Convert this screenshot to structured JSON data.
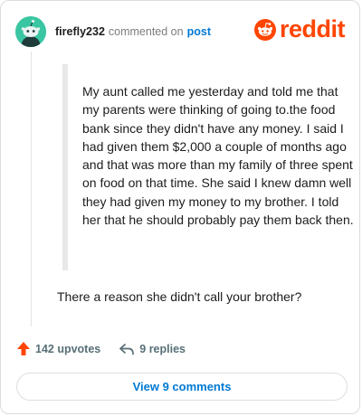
{
  "comment": {
    "username": "firefly232",
    "commented_on": "commented on",
    "post_link": "post",
    "avatar_color": "#3ac6a2",
    "quote": "My aunt called me yesterday and told me that my parents were thinking of going to.the food bank since they didn't have any money. I said I had given them $2,000 a couple of months ago and that was more than my family of three spent on food on that time. She said I knew damn well they had given my money to my brother. I told her that he should probably pay them back then.",
    "reply": "There a reason she didn't call your brother?"
  },
  "brand": {
    "name": "reddit",
    "color": "#ff4500",
    "icon": "reddit-snoo-icon"
  },
  "actions": {
    "upvotes": "142 upvotes",
    "upvote_icon": "upvote-arrow-icon",
    "replies": "9 replies",
    "reply_icon": "reply-arrow-icon"
  },
  "footer": {
    "view_comments": "View 9 comments"
  }
}
